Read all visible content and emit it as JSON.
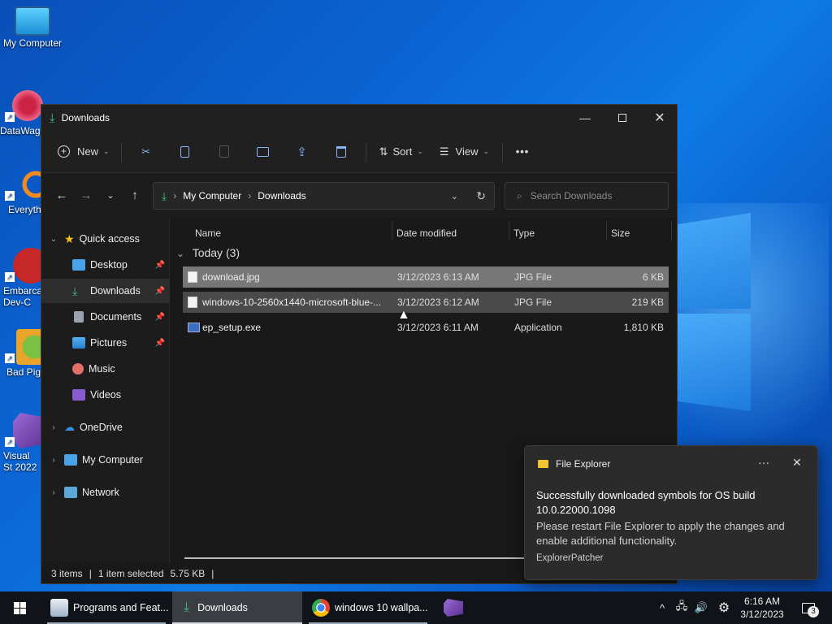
{
  "desktop": {
    "icons": [
      {
        "label": "My Computer"
      },
      {
        "label": "DataWag"
      },
      {
        "label": "Everyth"
      },
      {
        "label": "Embarca Dev-C"
      },
      {
        "label": "Bad Pigi"
      },
      {
        "label": "Visual St 2022"
      }
    ]
  },
  "window": {
    "title": "Downloads",
    "toolbar": {
      "new_label": "New",
      "sort_label": "Sort",
      "view_label": "View",
      "more_label": "•••"
    },
    "address": {
      "root": "My Computer",
      "current": "Downloads"
    },
    "search": {
      "placeholder": "Search Downloads"
    },
    "sidebar": {
      "quick_access": "Quick access",
      "items": [
        {
          "label": "Desktop"
        },
        {
          "label": "Downloads"
        },
        {
          "label": "Documents"
        },
        {
          "label": "Pictures"
        },
        {
          "label": "Music"
        },
        {
          "label": "Videos"
        }
      ],
      "onedrive": "OneDrive",
      "my_computer": "My Computer",
      "network": "Network"
    },
    "columns": {
      "name": "Name",
      "date": "Date modified",
      "type": "Type",
      "size": "Size"
    },
    "group": "Today (3)",
    "files": [
      {
        "name": "download.jpg",
        "date": "3/12/2023 6:13 AM",
        "type": "JPG File",
        "size": "6 KB"
      },
      {
        "name": "windows-10-2560x1440-microsoft-blue-...",
        "date": "3/12/2023 6:12 AM",
        "type": "JPG File",
        "size": "219 KB"
      },
      {
        "name": "ep_setup.exe",
        "date": "3/12/2023 6:11 AM",
        "type": "Application",
        "size": "1,810 KB"
      }
    ],
    "status": {
      "items": "3 items",
      "selected": "1 item selected",
      "size": "5.75 KB"
    }
  },
  "notification": {
    "app": "File Explorer",
    "more": "···",
    "headline": "Successfully downloaded symbols for OS build 10.0.22000.1098",
    "body": "Please restart File Explorer to apply the changes and enable additional functionality.",
    "source": "ExplorerPatcher"
  },
  "taskbar": {
    "apps": [
      {
        "label": "Programs and Feat..."
      },
      {
        "label": "Downloads"
      },
      {
        "label": "windows 10 wallpa..."
      }
    ],
    "time": "6:16 AM",
    "date": "3/12/2023",
    "notification_count": "3"
  }
}
